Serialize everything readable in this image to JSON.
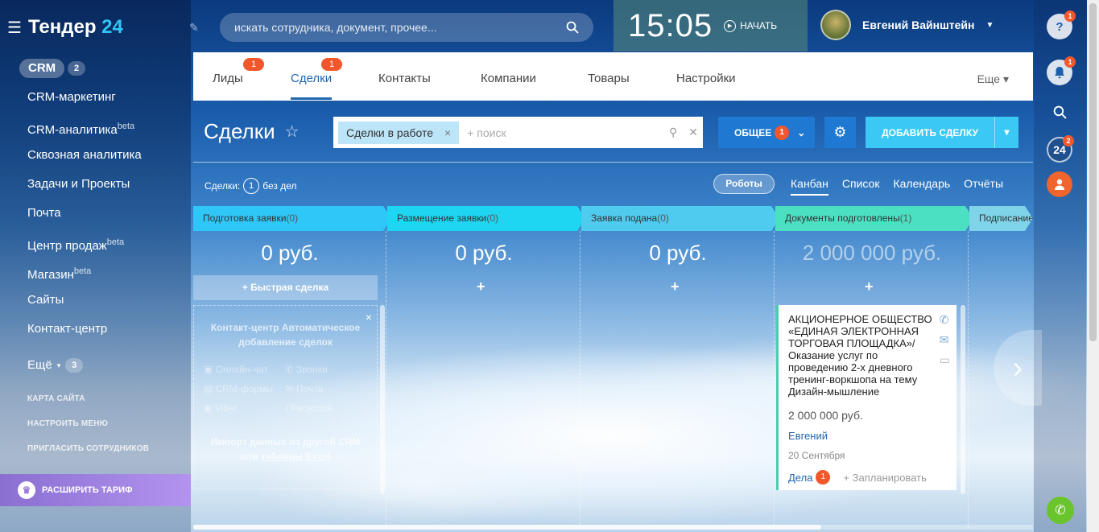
{
  "logo": {
    "name": "Тендер",
    "num": "24"
  },
  "sidebar": {
    "crm_label": "CRM",
    "crm_count": "2",
    "items": [
      {
        "label": "CRM-маркетинг",
        "sup": ""
      },
      {
        "label": "CRM-аналитика",
        "sup": "beta"
      },
      {
        "label": "Сквозная аналитика",
        "sup": ""
      },
      {
        "label": "Задачи и Проекты",
        "sup": ""
      },
      {
        "label": "Почта",
        "sup": ""
      },
      {
        "label": "Центр продаж",
        "sup": "beta"
      },
      {
        "label": "Магазин",
        "sup": "beta"
      },
      {
        "label": "Сайты",
        "sup": ""
      },
      {
        "label": "Контакт-центр",
        "sup": ""
      }
    ],
    "more_label": "Ещё",
    "more_count": "3",
    "small_links": [
      "КАРТА САЙТА",
      "НАСТРОИТЬ МЕНЮ",
      "ПРИГЛАСИТЬ СОТРУДНИКОВ"
    ],
    "tariff_label": "РАСШИРИТЬ ТАРИФ"
  },
  "search": {
    "placeholder": "искать сотрудника, документ, прочее..."
  },
  "clock": {
    "time": "15:05",
    "start_label": "НАЧАТЬ"
  },
  "user": {
    "name": "Евгений Вайнштейн"
  },
  "tabs": {
    "items": [
      {
        "label": "Лиды",
        "badge": "1"
      },
      {
        "label": "Сделки",
        "badge": "1"
      },
      {
        "label": "Контакты",
        "badge": ""
      },
      {
        "label": "Компании",
        "badge": ""
      },
      {
        "label": "Товары",
        "badge": ""
      },
      {
        "label": "Настройки",
        "badge": ""
      }
    ],
    "more": "Еще"
  },
  "page": {
    "title": "Сделки"
  },
  "filter": {
    "chip": "Сделки в работе",
    "placeholder": "+ поиск"
  },
  "buttons": {
    "general": "ОБЩЕЕ",
    "general_badge": "1",
    "add": "ДОБАВИТЬ СДЕЛКУ"
  },
  "counts": {
    "label": "Сделки:",
    "count": "1",
    "suffix": "без дел"
  },
  "robots": "Роботы",
  "views": [
    "Канбан",
    "Список",
    "Календарь",
    "Отчёты"
  ],
  "stages": [
    {
      "name": "Подготовка заявки",
      "count": "(0)",
      "color": "#2fc7f7",
      "sum": "0 руб."
    },
    {
      "name": "Размещение заявки",
      "count": "(0)",
      "color": "#1ed6f2",
      "sum": "0 руб."
    },
    {
      "name": "Заявка подана",
      "count": "(0)",
      "color": "#4fcbf0",
      "sum": "0 руб."
    },
    {
      "name": "Документы подготовлены",
      "count": "(1)",
      "color": "#4be0c2",
      "sum": "2 000 000 руб."
    },
    {
      "name": "Подписание",
      "count": "",
      "color": "#7fd4ea",
      "sum": ""
    }
  ],
  "quick_deal": "Быстрая сделка",
  "empty_panel": {
    "title": "Контакт-центр Автоматическое добавление сделок",
    "channels": [
      "Онлайн-чат",
      "Звонки",
      "CRM-формы",
      "Почта",
      "Viber",
      "Facebook"
    ],
    "import_prefix": "Импорт данных из другой CRM",
    "import_mid": "или",
    "import_link": "таблицы Excel"
  },
  "card": {
    "title": "АКЦИОНЕРНОЕ ОБЩЕСТВО «ЕДИНАЯ ЭЛЕКТРОННАЯ ТОРГОВАЯ ПЛОЩАДКА»/ Оказание услуг по проведению 2-х дневного тренинг-воркшопа на тему Дизайн-мышление",
    "price": "2 000 000 руб.",
    "person": "Евгений",
    "date": "20 Сентября",
    "tasks_label": "Дела",
    "tasks_count": "1",
    "plan_label": "+ Запланировать"
  },
  "right_panel": {
    "help_badge": "1",
    "bell_badge": "1",
    "b24_label": "24",
    "b24_badge": "2"
  }
}
